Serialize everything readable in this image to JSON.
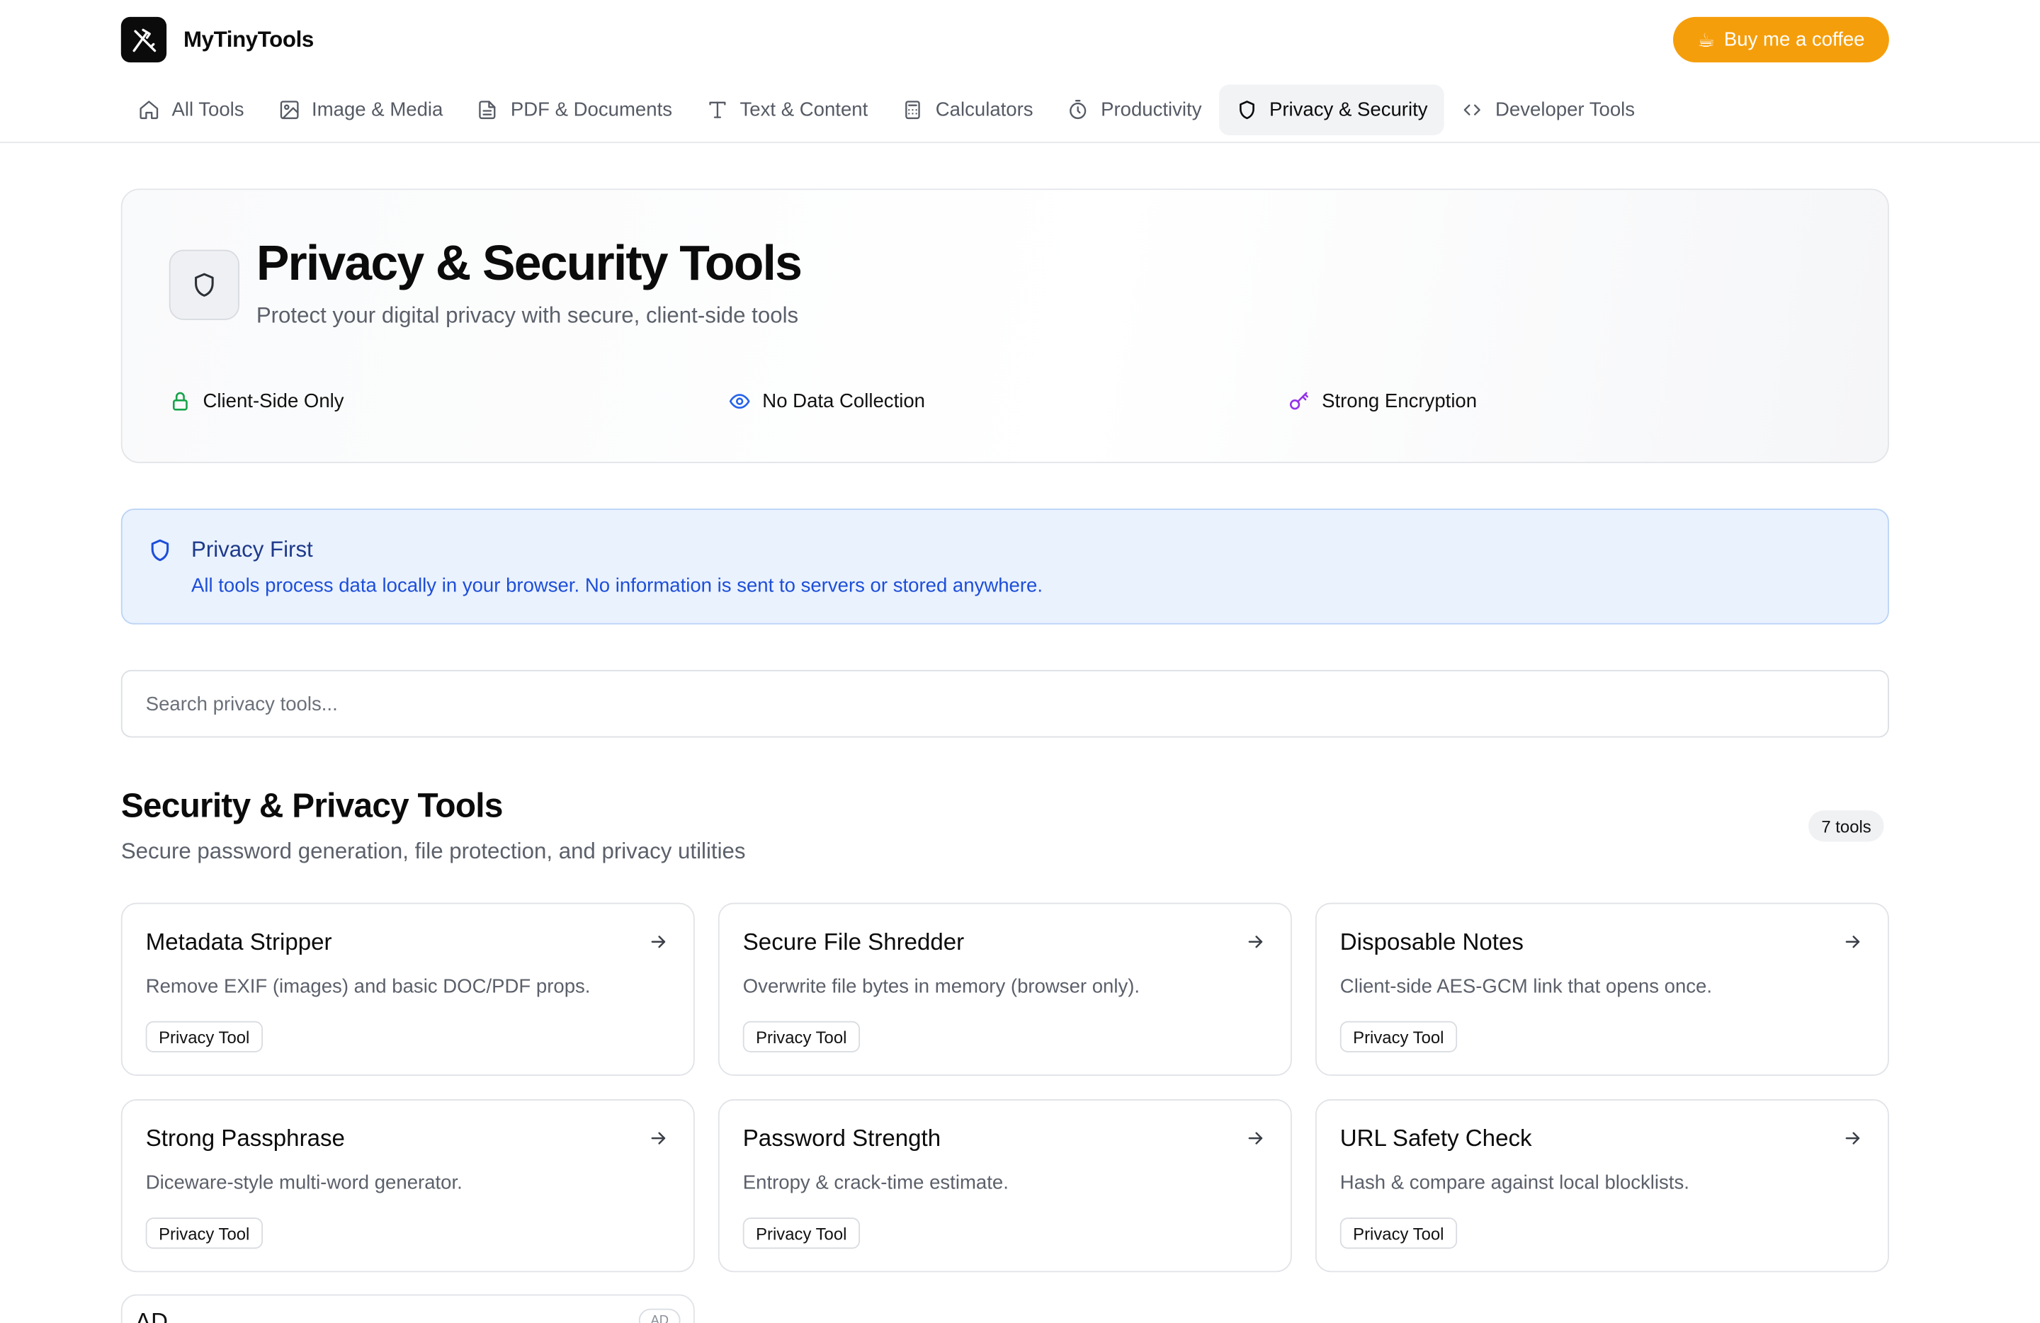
{
  "brand": {
    "name": "MyTinyTools",
    "logo_icon": "knife-tools-icon"
  },
  "header": {
    "coffee_label": "Buy me a coffee",
    "coffee_emoji": "☕",
    "accent": "#f59e0b"
  },
  "nav": {
    "active": "Privacy & Security",
    "items": [
      {
        "label": "All Tools",
        "icon": "home-icon"
      },
      {
        "label": "Image & Media",
        "icon": "image-icon"
      },
      {
        "label": "PDF & Documents",
        "icon": "file-icon"
      },
      {
        "label": "Text & Content",
        "icon": "text-icon"
      },
      {
        "label": "Calculators",
        "icon": "calculator-icon"
      },
      {
        "label": "Productivity",
        "icon": "timer-icon"
      },
      {
        "label": "Privacy & Security",
        "icon": "shield-icon"
      },
      {
        "label": "Developer Tools",
        "icon": "code-icon"
      }
    ]
  },
  "hero": {
    "title": "Privacy & Security Tools",
    "subtitle": "Protect your digital privacy with secure, client-side tools",
    "icon": "shield-icon",
    "features": [
      {
        "label": "Client-Side Only",
        "icon": "lock-icon",
        "color": "#16a34a"
      },
      {
        "label": "No Data Collection",
        "icon": "eye-icon",
        "color": "#2563eb"
      },
      {
        "label": "Strong Encryption",
        "icon": "key-icon",
        "color": "#9333ea"
      }
    ]
  },
  "info": {
    "title": "Privacy First",
    "text": "All tools process data locally in your browser. No information is sent to servers or stored anywhere.",
    "icon": "shield-icon"
  },
  "search": {
    "placeholder": "Search privacy tools...",
    "value": ""
  },
  "section": {
    "title": "Security & Privacy Tools",
    "subtitle": "Secure password generation, file protection, and privacy utilities",
    "count": "7 tools"
  },
  "tools": [
    {
      "title": "Metadata Stripper",
      "desc": "Remove EXIF (images) and basic DOC/PDF props.",
      "tag": "Privacy Tool"
    },
    {
      "title": "Secure File Shredder",
      "desc": "Overwrite file bytes in memory (browser only).",
      "tag": "Privacy Tool"
    },
    {
      "title": "Disposable Notes",
      "desc": "Client-side AES-GCM link that opens once.",
      "tag": "Privacy Tool"
    },
    {
      "title": "Strong Passphrase",
      "desc": "Diceware-style multi-word generator.",
      "tag": "Privacy Tool"
    },
    {
      "title": "Password Strength",
      "desc": "Entropy & crack-time estimate.",
      "tag": "Privacy Tool"
    },
    {
      "title": "URL Safety Check",
      "desc": "Hash & compare against local blocklists.",
      "tag": "Privacy Tool"
    }
  ],
  "ad": {
    "label": "AD",
    "badge": "AD"
  }
}
